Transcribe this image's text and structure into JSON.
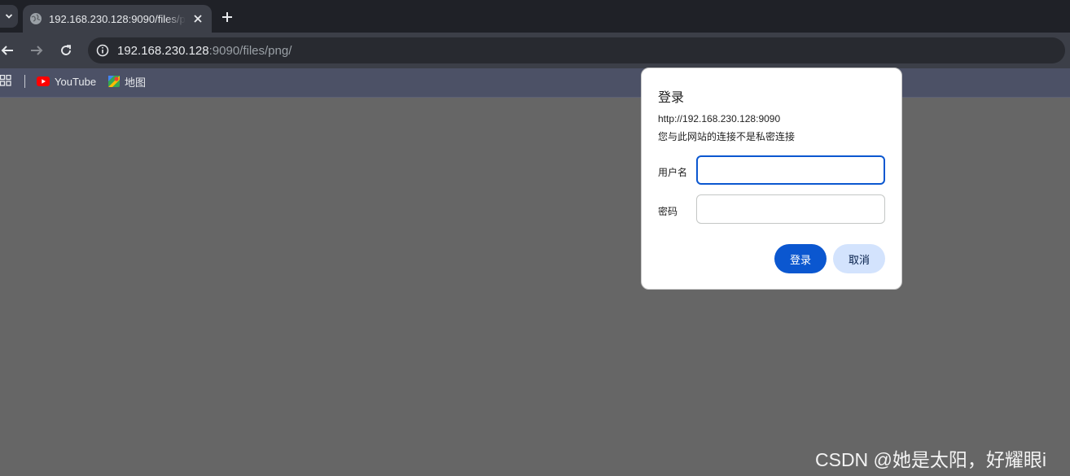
{
  "browser": {
    "tab": {
      "title": "192.168.230.128:9090/files/png/",
      "favicon": "globe-icon",
      "close_icon": "close-icon"
    },
    "new_tab_icon": "plus-icon",
    "tab_list_icon": "chevron-down-icon",
    "nav": {
      "back_icon": "arrow-left-icon",
      "forward_icon": "arrow-right-icon",
      "reload_icon": "reload-icon"
    },
    "address": {
      "host": "192.168.230.128",
      "rest": ":9090/files/png/",
      "info_icon": "info-icon"
    },
    "bookmarks": [
      {
        "label": "YouTube",
        "icon": "youtube-icon"
      },
      {
        "label": "地图",
        "icon": "maps-icon"
      }
    ],
    "apps_icon": "apps-grid-icon"
  },
  "dialog": {
    "title": "登录",
    "origin": "http://192.168.230.128:9090",
    "warning": "您与此网站的连接不是私密连接",
    "username_label": "用户名",
    "username_value": "",
    "password_label": "密码",
    "password_value": "",
    "submit_label": "登录",
    "cancel_label": "取消"
  },
  "watermark": "CSDN @她是太阳，好耀眼i",
  "colors": {
    "tab_strip": "#1f2127",
    "toolbar": "#3c3f48",
    "bookmarks_bar": "#4c5166",
    "page_background": "#666666",
    "primary_button": "#0b57d0",
    "secondary_button": "#d3e3fd"
  }
}
